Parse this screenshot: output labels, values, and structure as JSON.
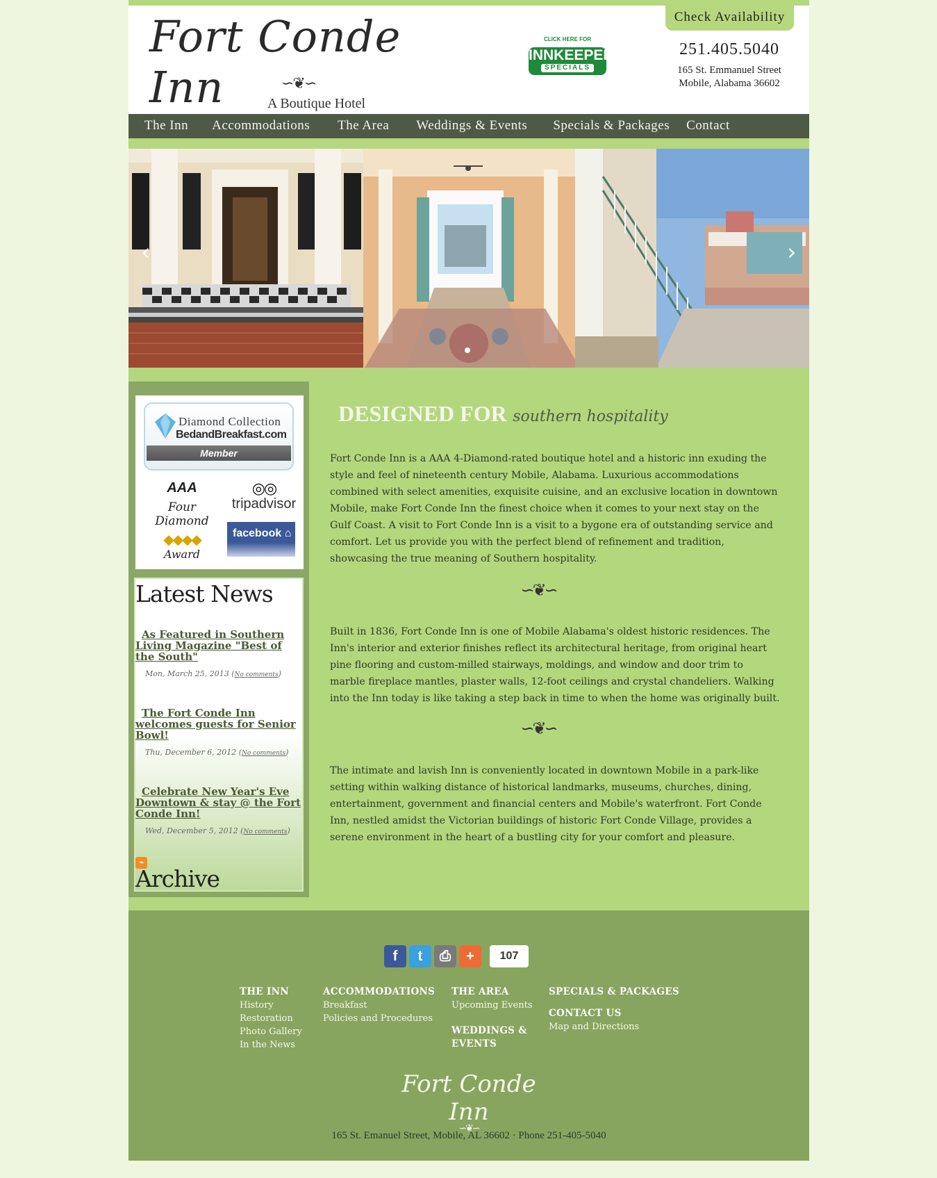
{
  "header": {
    "logo_title": "Fort Conde Inn",
    "logo_subtitle": "A Boutique Hotel",
    "innkeeper_click": "CLICK HERE FOR",
    "innkeeper_title": "INNKEEPER",
    "innkeeper_sub": "SPECIALS",
    "check_availability": "Check Availability",
    "phone": "251.405.5040",
    "address_line1": "165 St. Emmanuel Street",
    "address_line2": "Mobile, Alabama 36602"
  },
  "nav": {
    "items": [
      {
        "label": "The Inn"
      },
      {
        "label": "Accommodations"
      },
      {
        "label": "The Area"
      },
      {
        "label": "Weddings & Events"
      },
      {
        "label": "Specials & Packages"
      },
      {
        "label": "Contact"
      }
    ]
  },
  "slider": {
    "prev_arrow": "‹",
    "next_arrow": "›"
  },
  "sidebar": {
    "diamond_collection": "Diamond Collection",
    "bnb": "BedandBreakfast.com",
    "member": "Member",
    "aaa": "AAA",
    "four_diamond": "Four Diamond",
    "award": "Award",
    "tripadvisor": "tripadvisor",
    "facebook": "facebook",
    "latest_news_title": "Latest News",
    "news": [
      {
        "title": "As Featured in Southern Living Magazine \"Best of the South\"",
        "date": "Mon, March 25, 2013",
        "comments": "No comments"
      },
      {
        "title": "The Fort Conde Inn welcomes guests for Senior Bowl!",
        "date": "Thu, December 6, 2012",
        "comments": "No comments"
      },
      {
        "title": "Celebrate New Year's Eve Downtown & stay @ the Fort Conde Inn!",
        "date": "Wed, December 5, 2012",
        "comments": "No comments"
      }
    ],
    "archive_title": "Archive"
  },
  "main": {
    "heading_bold": "DESIGNED FOR",
    "heading_script": "southern hospitality",
    "paragraphs": [
      "Fort Conde Inn is a AAA 4-Diamond-rated boutique hotel and a historic inn exuding the style and feel of nineteenth century Mobile, Alabama. Luxurious accommodations combined with select amenities, exquisite cuisine, and an exclusive location in downtown Mobile, make Fort Conde Inn the finest choice when it comes to your next stay on the Gulf Coast. A visit to Fort Conde Inn is a visit to a bygone era of outstanding service and comfort. Let us provide you with the perfect blend of refinement and tradition, showcasing the true meaning of Southern hospitality.",
      "Built in 1836, Fort Conde Inn is one of Mobile Alabama's oldest historic residences. The Inn's interior and exterior finishes reflect its architectural heritage, from original heart pine flooring and custom-milled stairways, moldings, and window and door trim to marble fireplace mantles, plaster walls, 12-foot ceilings and crystal chandeliers. Walking into the Inn today is like taking a step back in time to when the home was originally built.",
      "The intimate and lavish Inn is conveniently located in downtown Mobile in a park-like setting within walking distance of historical landmarks, museums, churches, dining, entertainment, government and financial centers and Mobile's waterfront. Fort Conde Inn, nestled amidst the Victorian buildings of historic Fort Conde Village, provides a serene environment in the heart of a bustling city for your comfort and pleasure."
    ]
  },
  "footer": {
    "share_count": "107",
    "columns": [
      {
        "heading": "THE INN",
        "links": [
          "History",
          "Restoration",
          "Photo Gallery",
          "In the News"
        ]
      },
      {
        "heading": "ACCOMMODATIONS",
        "links": [
          "Breakfast",
          "Policies and Procedures"
        ]
      },
      {
        "heading": "THE AREA",
        "links": [
          "Upcoming Events"
        ],
        "heading2": "WEDDINGS &",
        "heading2b": "EVENTS"
      },
      {
        "heading": "SPECIALS & PACKAGES",
        "heading2": "CONTACT US",
        "links": [
          "Map and Directions"
        ]
      }
    ],
    "logo": "Fort Conde Inn",
    "address": "165 St. Emanuel Street, Mobile, AL 36602 · Phone 251-405-5040"
  },
  "colors": {
    "page_bg": "#eef6e0",
    "accent_green": "#b5d77e",
    "nav_bg": "#4e5a45",
    "footer_bg": "#87a55f"
  }
}
